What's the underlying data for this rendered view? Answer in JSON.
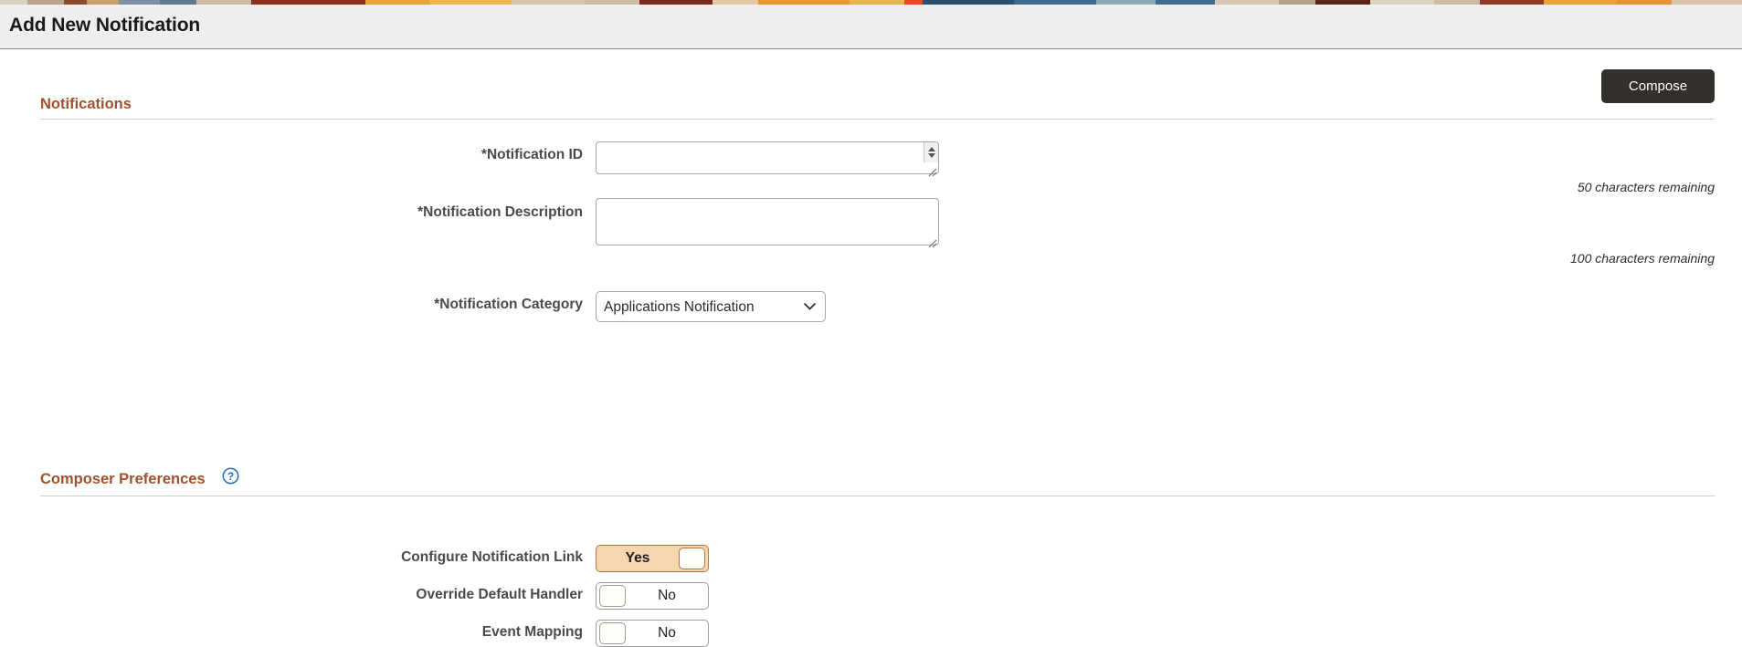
{
  "page": {
    "title": "Add New Notification"
  },
  "toolbar": {
    "compose_label": "Compose"
  },
  "sections": {
    "notifications": {
      "title": "Notifications"
    },
    "composer_preferences": {
      "title": "Composer Preferences",
      "help_icon": "help-circle-icon"
    }
  },
  "form": {
    "notification_id": {
      "label": "*Notification ID",
      "value": "",
      "placeholder": "",
      "counter": "50 characters remaining",
      "spinner_icon": "spinner-updown-icon",
      "grip_icon": "resize-grip-icon"
    },
    "notification_description": {
      "label": "*Notification Description",
      "value": "",
      "placeholder": "",
      "counter": "100 characters remaining",
      "grip_icon": "resize-grip-icon"
    },
    "notification_category": {
      "label": "*Notification Category",
      "selected": "Applications Notification",
      "chevron_icon": "chevron-down-icon",
      "options": [
        "Applications Notification"
      ]
    }
  },
  "preferences": [
    {
      "label": "Configure Notification Link",
      "state": "Yes",
      "on": true
    },
    {
      "label": "Override Default Handler",
      "state": "No",
      "on": false
    },
    {
      "label": "Event Mapping",
      "state": "No",
      "on": false
    }
  ],
  "colors": {
    "accent_heading": "#a0522d",
    "title_bar_bg": "#efeeec",
    "compose_bg": "#332f2c",
    "toggle_on_bg": "#f5d6af",
    "help_icon": "#1f6fb4"
  }
}
